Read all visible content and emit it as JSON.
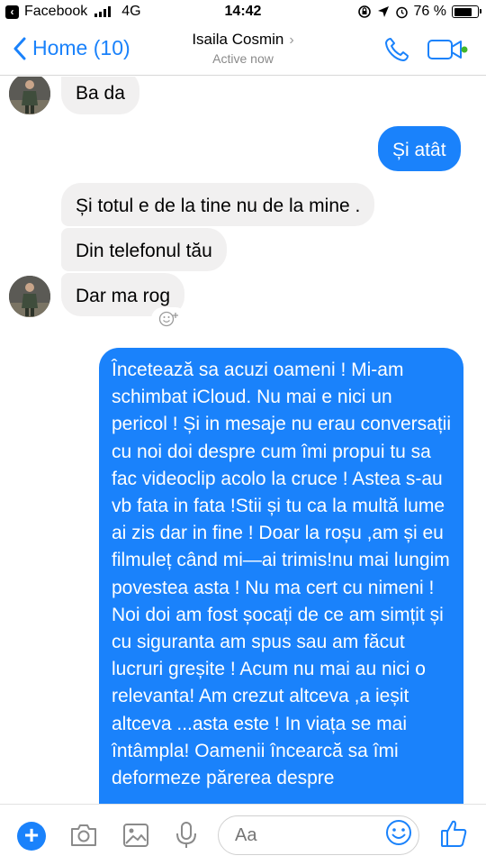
{
  "status_bar": {
    "carrier": "Facebook",
    "network": "4G",
    "time": "14:42",
    "battery": "76 %",
    "battery_level": 0.76
  },
  "header": {
    "back_label": "Home (10)",
    "contact_name": "Isaila Cosmin",
    "status": "Active now",
    "call_icon": "phone-icon",
    "video_icon": "video-camera-icon",
    "accent": "#1a82fb"
  },
  "messages": [
    {
      "from": "them",
      "text": "Ba da"
    },
    {
      "from": "me",
      "text": "Și atât"
    },
    {
      "from": "them",
      "text": "Și totul e de la tine nu de la mine ."
    },
    {
      "from": "them",
      "text": "Din telefonul tău"
    },
    {
      "from": "them",
      "text": "Dar ma rog"
    },
    {
      "from": "me",
      "text": "Încetează sa acuzi oameni ! Mi-am schimbat iCloud. Nu mai e nici un pericol ! Și in mesaje nu erau conversații cu noi doi despre cum îmi propui tu sa fac videoclip acolo la cruce ! Astea s-au vb fata in fata !Stii și tu ca la multă lume ai zis dar in fine ! Doar la roșu ,am și eu filmuleț când mi—ai trimis!nu mai lungim povestea asta ! Nu ma cert cu nimeni ! Noi doi am fost șocați de ce am simțit și cu siguranta am spus sau am făcut lucruri  greșite ! Acum nu mai au nici o relevanta! Am crezut altceva ,a ieșit altceva ...asta este ! In viața se mai întâmpla! Oamenii încearcă sa îmi deformeze părerea despre"
    }
  ],
  "composer": {
    "placeholder": "Aa",
    "icons": [
      "plus-icon",
      "camera-icon",
      "gallery-icon",
      "microphone-icon",
      "emoji-icon",
      "thumbs-up-icon"
    ]
  },
  "colors": {
    "outgoing_bubble": "#1a82fb",
    "incoming_bubble": "#f1f0f0"
  }
}
